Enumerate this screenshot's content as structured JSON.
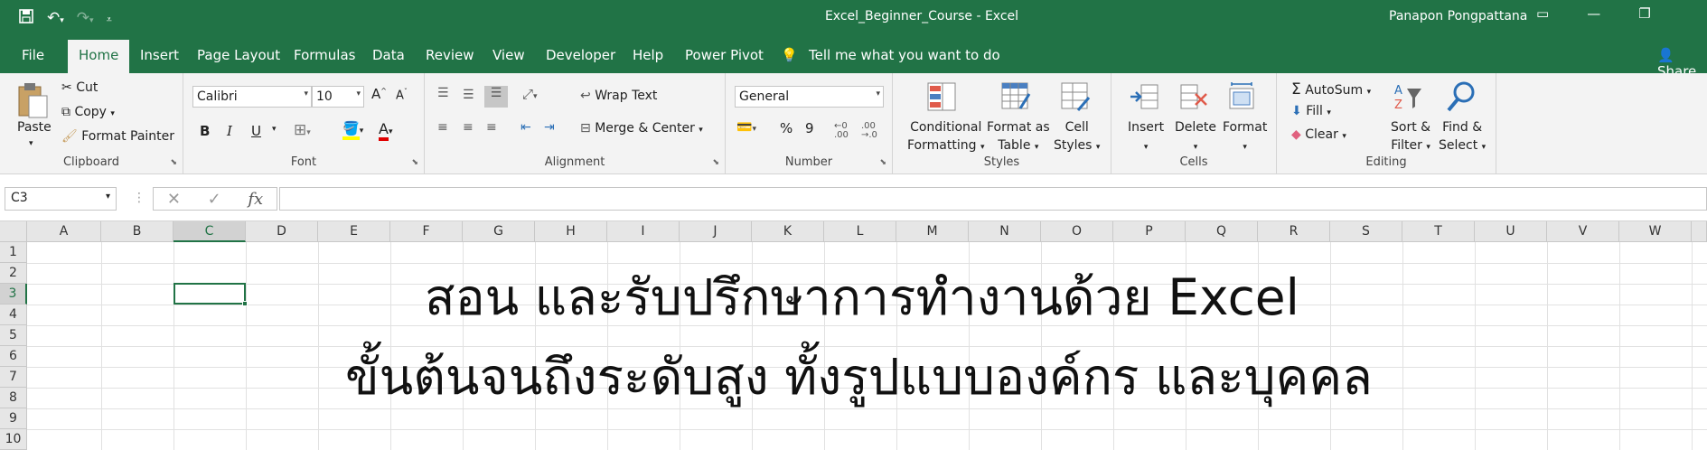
{
  "titlebar": {
    "title": "Excel_Beginner_Course  -  Excel",
    "user": "Panapon Pongpattana",
    "save_icon": "save-icon",
    "undo_icon": "undo-icon",
    "redo_icon": "redo-icon"
  },
  "tabs": [
    "File",
    "Home",
    "Insert",
    "Page Layout",
    "Formulas",
    "Data",
    "Review",
    "View",
    "Developer",
    "Help",
    "Power Pivot"
  ],
  "tell_me": "Tell me what you want to do",
  "share": "Share",
  "ribbon": {
    "clipboard": {
      "label": "Clipboard",
      "paste": "Paste",
      "cut": "Cut",
      "copy": "Copy",
      "format_painter": "Format Painter"
    },
    "font": {
      "label": "Font",
      "name": "Calibri",
      "size": "10",
      "bold": "B",
      "italic": "I",
      "underline": "U"
    },
    "alignment": {
      "label": "Alignment",
      "wrap_text": "Wrap Text",
      "merge_center": "Merge & Center"
    },
    "number": {
      "label": "Number",
      "format": "General",
      "percent": "%",
      "comma": "9"
    },
    "styles": {
      "label": "Styles",
      "conditional": [
        "Conditional",
        "Formatting"
      ],
      "format_table": [
        "Format as",
        "Table"
      ],
      "cell_styles": [
        "Cell",
        "Styles"
      ]
    },
    "cells": {
      "label": "Cells",
      "insert": "Insert",
      "delete": "Delete",
      "format": "Format"
    },
    "editing": {
      "label": "Editing",
      "autosum": "AutoSum",
      "fill": "Fill",
      "clear": "Clear",
      "sort": [
        "Sort &",
        "Filter"
      ],
      "find": [
        "Find &",
        "Select"
      ]
    }
  },
  "formula_bar": {
    "name_box": "C3",
    "value": ""
  },
  "columns": [
    "A",
    "B",
    "C",
    "D",
    "E",
    "F",
    "G",
    "H",
    "I",
    "J",
    "K",
    "L",
    "M",
    "N",
    "O",
    "P",
    "Q",
    "R",
    "S",
    "T",
    "U",
    "V",
    "W"
  ],
  "rows": [
    "1",
    "2",
    "3",
    "4",
    "5",
    "6",
    "7",
    "8",
    "9",
    "10"
  ],
  "selected_cell": {
    "column": "C",
    "row": "3"
  },
  "sheet_text": {
    "line1": "สอน และรับปรึกษาการทำงานด้วย Excel",
    "line2": "ขั้นต้นจนถึงระดับสูง ทั้งรูปแบบองค์กร และบุคคล"
  },
  "colors": {
    "excel_green": "#217346",
    "ribbon_bg": "#f3f3f3"
  }
}
